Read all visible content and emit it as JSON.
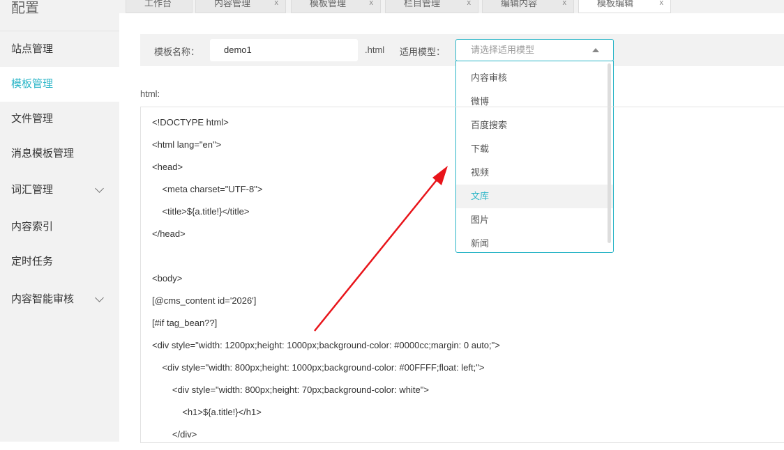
{
  "sidebar": {
    "title": "配置",
    "items": [
      {
        "label": "站点管理"
      },
      {
        "label": "模板管理",
        "active": true
      },
      {
        "label": "文件管理"
      },
      {
        "label": "消息模板管理"
      },
      {
        "label": "词汇管理",
        "expandable": true
      },
      {
        "label": "内容索引"
      },
      {
        "label": "定时任务"
      },
      {
        "label": "内容智能审核",
        "expandable": true
      }
    ]
  },
  "tabs": [
    {
      "label": "工作台"
    },
    {
      "label": "内容管理",
      "close": "x"
    },
    {
      "label": "模板管理",
      "close": "x"
    },
    {
      "label": "栏目管理",
      "close": "x"
    },
    {
      "label": "编辑内容",
      "close": "x"
    },
    {
      "label": "模板编辑",
      "close": "x"
    }
  ],
  "form": {
    "name_label": "模板名称：",
    "name_value": "demo1",
    "suffix": ".html",
    "model_label": "适用模型：",
    "model_placeholder": "请选择适用模型",
    "options": [
      "内容审核",
      "微博",
      "百度搜索",
      "下载",
      "视频",
      "文库",
      "图片",
      "新闻"
    ],
    "highlighted": "文库"
  },
  "editor": {
    "label": "html:",
    "lines": [
      "<!DOCTYPE html>",
      "<html lang=\"en\">",
      "<head>",
      "    <meta charset=\"UTF-8\">",
      "    <title>${a.title!}</title>",
      "</head>",
      "",
      "<body>",
      "[@cms_content id='2026']",
      "[#if tag_bean??]",
      "<div style=\"width: 1200px;height: 1000px;background-color: #0000cc;margin: 0 auto;\">",
      "    <div style=\"width: 800px;height: 1000px;background-color: #00FFFF;float: left;\">",
      "        <div style=\"width: 800px;height: 70px;background-color: white\">",
      "            <h1>${a.title!}</h1>",
      "        </div>"
    ]
  },
  "colors": {
    "accent": "#2ab5c7",
    "arrow": "#e8141a"
  }
}
